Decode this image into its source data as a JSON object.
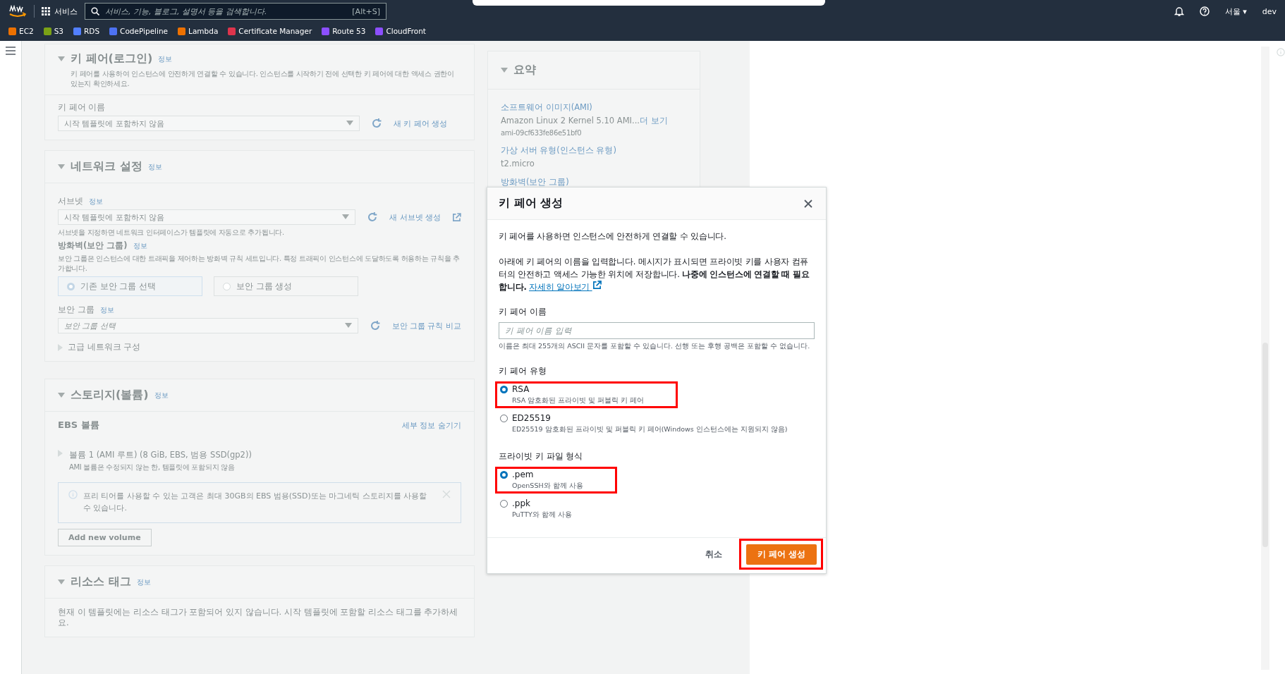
{
  "top_nav": {
    "services": "서비스",
    "search": {
      "placeholder": "서비스, 기능, 블로그, 설명서 등을 검색합니다.",
      "shortcut": "[Alt+S]"
    },
    "region": "서울",
    "region_caret": "▾",
    "account": "dev"
  },
  "favorites": [
    {
      "label": "EC2",
      "color": "#ed7100"
    },
    {
      "label": "S3",
      "color": "#7aa116"
    },
    {
      "label": "RDS",
      "color": "#527fff"
    },
    {
      "label": "CodePipeline",
      "color": "#4d72f3"
    },
    {
      "label": "Lambda",
      "color": "#ed7100"
    },
    {
      "label": "Certificate Manager",
      "color": "#dd344c"
    },
    {
      "label": "Route 53",
      "color": "#8c4fff"
    },
    {
      "label": "CloudFront",
      "color": "#8c4fff"
    }
  ],
  "key_pair_section": {
    "title": "키 페어(로그인)",
    "info": "정보",
    "description": "키 페어를 사용하여 인스턴스에 안전하게 연결할 수 있습니다. 인스턴스를 시작하기 전에 선택한 키 페어에 대한 액세스 권한이 있는지 확인하세요.",
    "field_label": "키 페어 이름",
    "select_value": "시작 템플릿에 포함하지 않음",
    "action": "새 키 페어 생성"
  },
  "network_section": {
    "title": "네트워크 설정",
    "info": "정보",
    "subnet_label": "서브넷",
    "subnet_info": "정보",
    "subnet_value": "시작 템플릿에 포함하지 않음",
    "subnet_action": "새 서브넷 생성",
    "subnet_hint": "서브넷을 지정하면 네트워크 인터페이스가 템플릿에 자동으로 추가됩니다.",
    "firewall_label": "방화벽(보안 그룹)",
    "firewall_info": "정보",
    "firewall_description": "보안 그룹은 인스턴스에 대한 트래픽을 제어하는 방화벽 규칙 세트입니다. 특정 트래픽이 인스턴스에 도달하도록 허용하는 규칙을 추가합니다.",
    "firewall_options": [
      {
        "label": "기존 보안 그룹 선택",
        "selected": true
      },
      {
        "label": "보안 그룹 생성",
        "selected": false
      }
    ],
    "group_label": "보안 그룹",
    "group_info": "정보",
    "group_placeholder": "보안 그룹 선택",
    "group_action": "보안 그룹 규칙 비교",
    "advanced": "고급 네트워크 구성"
  },
  "storage_section": {
    "title": "스토리지(볼륨)",
    "info": "정보",
    "ebs_title": "EBS 볼륨",
    "hide_details": "세부 정보 숨기기",
    "volume": "볼륨 1 (AMI 루트) (8 GiB, EBS, 범용 SSD(gp2))",
    "volume_note": "AMI 볼륨은 수정되지 않는 한, 템플릿에 포함되지 않음",
    "alert": "프리 티어를 사용할 수 있는 고객은 최대 30GB의 EBS 범용(SSD)또는 마그네틱 스토리지를 사용할 수 있습니다.",
    "add_button": "Add new volume"
  },
  "tags_section": {
    "title": "리소스 태그",
    "info": "정보",
    "description": "현재 이 템플릿에는 리소스 태그가 포함되어 있지 않습니다. 시작 템플릿에 포함할 리소스 태그를 추가하세요."
  },
  "summary": {
    "title": "요약",
    "ami_label": "소프트웨어 이미지(AMI)",
    "ami_value": "Amazon Linux 2 Kernel 5.10 AMI...",
    "ami_more": "더 보기",
    "ami_id": "ami-09cf633fe86e51bf0",
    "type_label": "가상 서버 유형(인스턴스 유형)",
    "type_value": "t2.micro",
    "firewall_label": "방화벽(보안 그룹)"
  },
  "modal": {
    "title": "키 페어 생성",
    "intro": "키 페어를 사용하면 인스턴스에 안전하게 연결할 수 있습니다.",
    "body": "아래에 키 페어의 이름을 입력합니다. 메시지가 표시되면 프라이빗 키를 사용자 컴퓨터의 안전하고 액세스 가능한 위치에 저장합니다. **나중에 인스턴스에 연결할 때 필요합니다.**",
    "link": "자세히 알아보기",
    "name_label": "키 페어 이름",
    "name_placeholder": "키 페어 이름 입력",
    "name_hint": "이름은 최대 255개의 ASCII 문자를 포함할 수 있습니다. 선행 또는 후행 공백은 포함할 수 없습니다.",
    "groups": [
      {
        "label": "키 페어 유형",
        "options": [
          {
            "label": "RSA",
            "description": "RSA 암호화된 프라이빗 및 퍼블릭 키 페어",
            "selected": true,
            "highlighted": true
          },
          {
            "label": "ED25519",
            "description": "ED25519 암호화된 프라이빗 및 퍼블릭 키 페어(Windows 인스턴스에는 지원되지 않음)",
            "selected": false,
            "highlighted": false
          }
        ]
      },
      {
        "label": "프라이빗 키 파일 형식",
        "options": [
          {
            "label": ".pem",
            "description": "OpenSSH와 함께 사용",
            "selected": true,
            "highlighted": true
          },
          {
            "label": ".ppk",
            "description": "PuTTY와 함께 사용",
            "selected": false,
            "highlighted": false
          }
        ]
      }
    ],
    "cancel": "취소",
    "create": "키 페어 생성",
    "create_highlighted": true
  }
}
